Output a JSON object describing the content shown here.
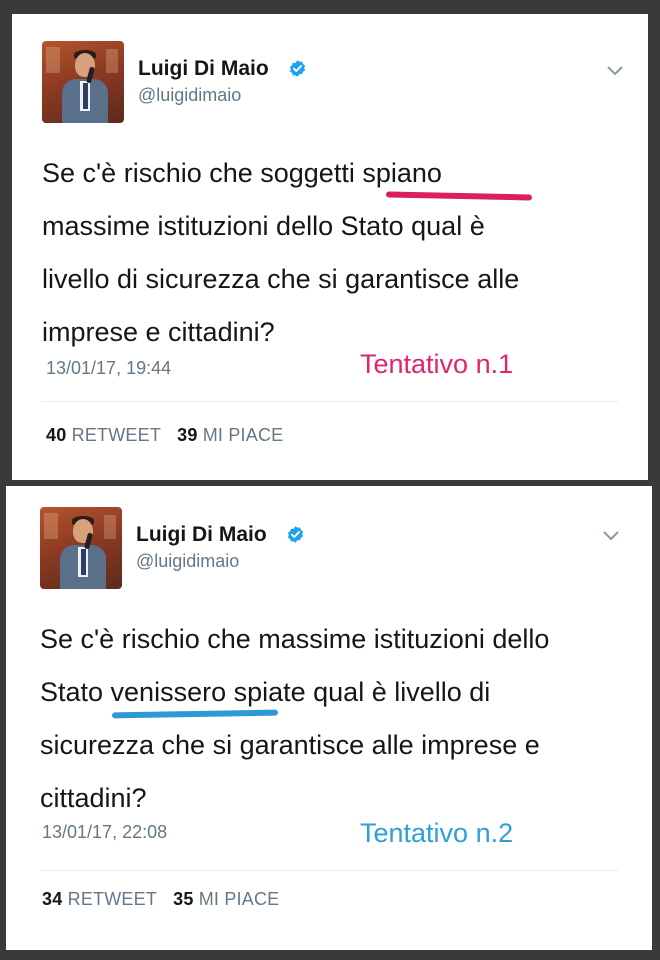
{
  "colors": {
    "verified": "#1da1f2",
    "attempt_1": "#e0246e",
    "attempt_2": "#2f9fd8",
    "underline_1": "#d91f5f",
    "underline_2": "#2c9ad6"
  },
  "tweets": [
    {
      "author_name": "Luigi Di Maio",
      "author_handle": "@luigidimaio",
      "verified_icon": "verified-badge-icon",
      "menu_icon": "chevron-down-icon",
      "text_lines": [
        "Se c'è rischio che soggetti spiano",
        "massime istituzioni dello Stato qual è",
        "livello di sicurezza che si garantisce alle",
        "imprese e cittadini?"
      ],
      "underlined_word": "spiano",
      "timestamp": "13/01/17, 19:44",
      "annotation": "Tentativo n.1",
      "retweets_count": "40",
      "retweets_label": "RETWEET",
      "likes_count": "39",
      "likes_label": "MI PIACE"
    },
    {
      "author_name": "Luigi Di Maio",
      "author_handle": "@luigidimaio",
      "verified_icon": "verified-badge-icon",
      "menu_icon": "chevron-down-icon",
      "text_lines": [
        "Se c'è rischio che massime istituzioni dello",
        "Stato venissero spiate qual è livello di",
        "sicurezza che si garantisce alle imprese e",
        "cittadini?"
      ],
      "underlined_word": "venissero",
      "timestamp": "13/01/17, 22:08",
      "annotation": "Tentativo n.2",
      "retweets_count": "34",
      "retweets_label": "RETWEET",
      "likes_count": "35",
      "likes_label": "MI PIACE"
    }
  ]
}
